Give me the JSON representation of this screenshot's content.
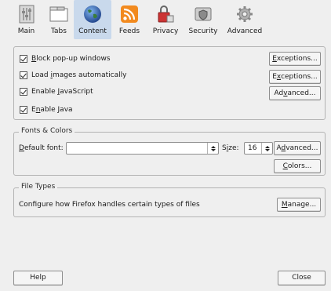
{
  "toolbar": {
    "tabs": [
      {
        "label": "Main",
        "icon": "main-icon"
      },
      {
        "label": "Tabs",
        "icon": "tabs-icon"
      },
      {
        "label": "Content",
        "icon": "globe-icon",
        "selected": true
      },
      {
        "label": "Feeds",
        "icon": "rss-feed-icon"
      },
      {
        "label": "Privacy",
        "icon": "privacy-lock-icon"
      },
      {
        "label": "Security",
        "icon": "security-icon"
      },
      {
        "label": "Advanced",
        "icon": "gear-icon"
      }
    ]
  },
  "content": {
    "checkboxes": [
      {
        "pre": "",
        "accel": "B",
        "post": "lock pop-up windows",
        "checked": true
      },
      {
        "pre": "Load ",
        "accel": "i",
        "post": "mages automatically",
        "checked": true
      },
      {
        "pre": "Enable ",
        "accel": "J",
        "post": "avaScript",
        "checked": true
      },
      {
        "pre": "E",
        "accel": "n",
        "post": "able Java",
        "checked": true
      }
    ],
    "buttons": [
      {
        "pre": "",
        "accel": "E",
        "post": "xceptions..."
      },
      {
        "pre": "E",
        "accel": "x",
        "post": "ceptions..."
      },
      {
        "pre": "Ad",
        "accel": "v",
        "post": "anced..."
      }
    ]
  },
  "fonts": {
    "legend": "Fonts & Colors",
    "default_font_pre": "",
    "default_font_accel": "D",
    "default_font_post": "efault font:",
    "default_font_value": "",
    "size_pre": "S",
    "size_accel": "i",
    "size_post": "ze:",
    "size_value": "16",
    "advanced_pre": "A",
    "advanced_accel": "d",
    "advanced_post": "vanced...",
    "colors_pre": "",
    "colors_accel": "C",
    "colors_post": "olors..."
  },
  "filetypes": {
    "legend": "File Types",
    "description": "Configure how Firefox handles certain types of files",
    "manage_pre": "",
    "manage_accel": "M",
    "manage_post": "anage..."
  },
  "footer": {
    "help_label": "Help",
    "close_label": "Close"
  },
  "colors": {
    "background": "#efefef",
    "selected_tab": "#c9d9ec"
  }
}
